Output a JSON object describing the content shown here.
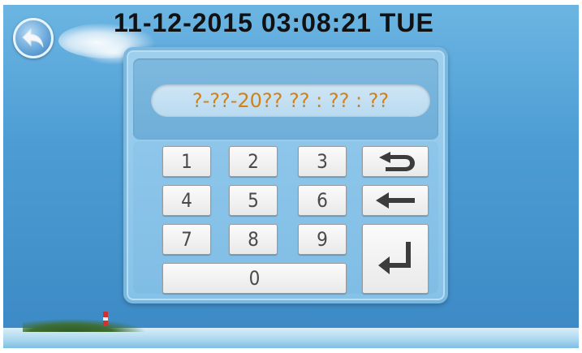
{
  "header": {
    "datetime": "11-12-2015  03:08:21  TUE"
  },
  "back_button": {
    "icon": "back-arrow-icon"
  },
  "keypad": {
    "display_value": "?-??-20?? ?? : ?? : ??",
    "keys": {
      "k1": "1",
      "k2": "2",
      "k3": "3",
      "k4": "4",
      "k5": "5",
      "k6": "6",
      "k7": "7",
      "k8": "8",
      "k9": "9",
      "k0": "0"
    },
    "icons": {
      "undo": "undo-icon",
      "backspace": "backspace-icon",
      "enter": "enter-icon"
    }
  },
  "colors": {
    "background": "#5fa7d6",
    "display_text": "#d08217",
    "panel": "#9ed0ee"
  }
}
